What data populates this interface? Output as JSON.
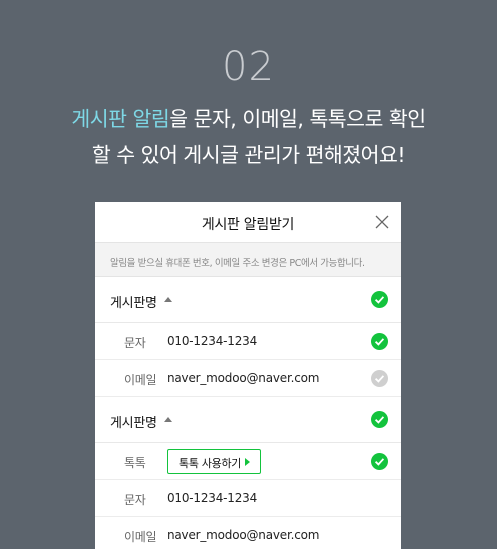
{
  "step": "02",
  "headline": {
    "line1_highlight": "게시판 알림",
    "line1_rest": "을 문자, 이메일, 톡톡으로 확인",
    "line2": "할 수 있어 게시글 관리가 편해졌어요!"
  },
  "panel": {
    "title": "게시판 알림받기",
    "close_icon": "close-icon",
    "notice": "알림을 받으실 휴대폰 번호, 이메일 주소 변경은 PC에서 가능합니다."
  },
  "boards": [
    {
      "name": "게시판명",
      "checked": true,
      "rows": [
        {
          "label": "문자",
          "value": "010-1234-1234",
          "checked": true
        },
        {
          "label": "이메일",
          "value": "naver_modoo@naver.com",
          "checked": false
        }
      ]
    },
    {
      "name": "게시판명",
      "checked": true,
      "talk": {
        "label": "톡톡",
        "button": "톡톡 사용하기",
        "checked": true
      },
      "rows": [
        {
          "label": "문자",
          "value": "010-1234-1234"
        },
        {
          "label": "이메일",
          "value": "naver_modoo@naver.com"
        }
      ]
    }
  ],
  "colors": {
    "background": "#5c646d",
    "highlight": "#7ed8e6",
    "check_on": "#13c33d",
    "check_off": "#cfcfcf"
  }
}
